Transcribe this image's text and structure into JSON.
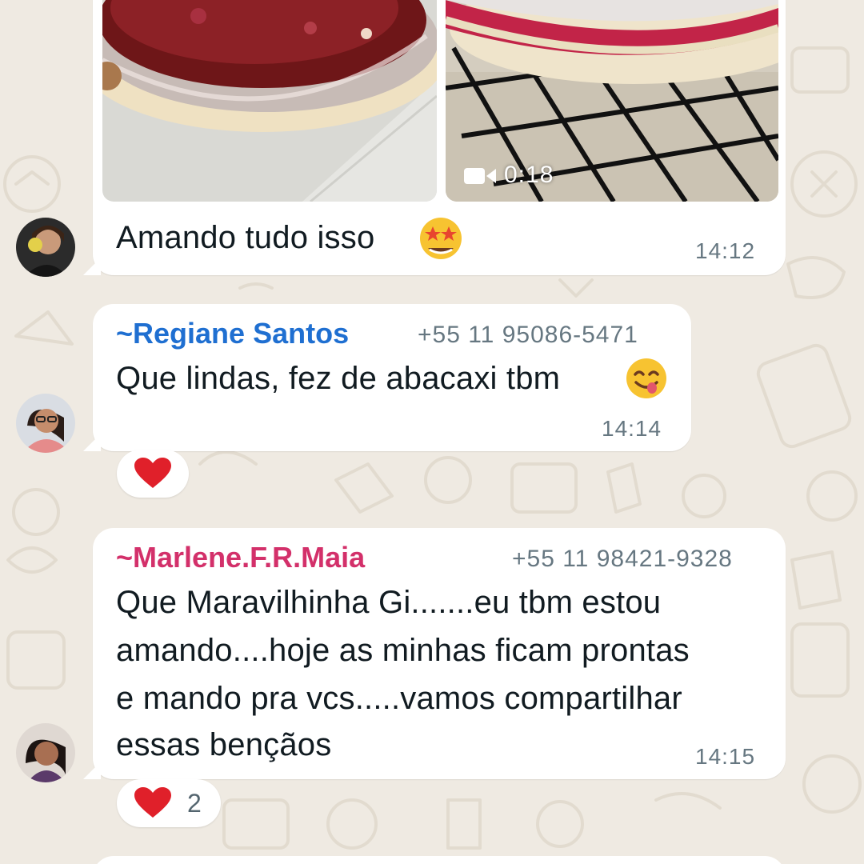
{
  "colors": {
    "background": "#efeae2",
    "bubble": "#ffffff",
    "regiane_name": "#1f6fd1",
    "marlene_name": "#d3306a",
    "timestamp": "#667781"
  },
  "messages": [
    {
      "id": "msg-media",
      "media": {
        "photo_icon": "dessert-photo",
        "video_icon": "video-camera-icon",
        "video_duration": "0:18"
      },
      "text": "Amando tudo isso",
      "emoji": "star-struck-emoji",
      "time": "14:12"
    },
    {
      "id": "msg-regiane",
      "sender": "~Regiane Santos",
      "phone": "+55 11 95086-5471",
      "text": "Que lindas, fez de abacaxi tbm",
      "emoji": "yum-face-emoji",
      "time": "14:14",
      "reaction": {
        "icon": "red-heart-emoji",
        "count": ""
      }
    },
    {
      "id": "msg-marlene",
      "sender": "~Marlene.F.R.Maia",
      "phone": "+55 11 98421-9328",
      "lines": [
        "Que Maravilhinha Gi.......eu tbm estou",
        "amando....hoje as minhas ficam prontas",
        "e mando pra vcs.....vamos compartilhar",
        "essas bençãos"
      ],
      "time": "14:15",
      "reaction": {
        "icon": "red-heart-emoji",
        "count": "2"
      }
    }
  ]
}
